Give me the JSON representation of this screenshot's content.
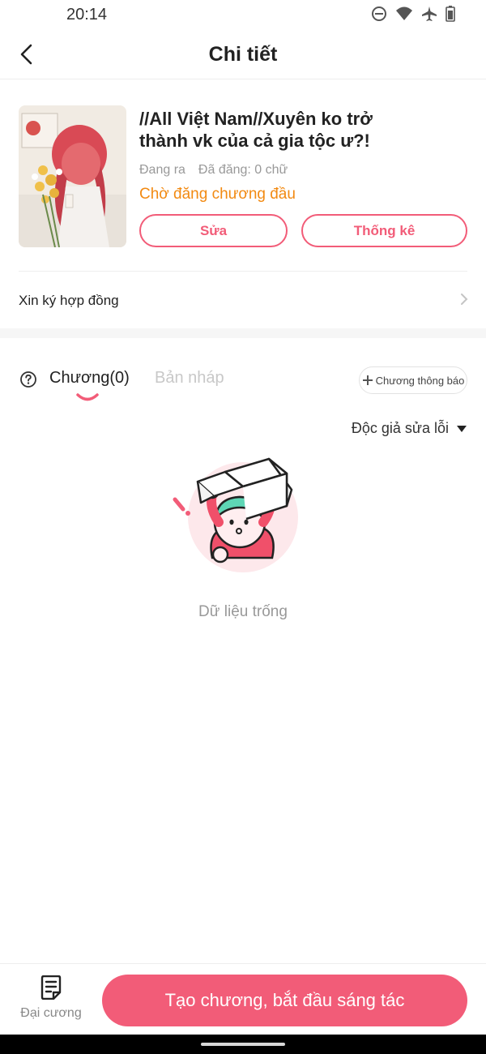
{
  "status_bar": {
    "time": "20:14",
    "icons": [
      "do-not-disturb-icon",
      "wifi-icon",
      "airplane-icon",
      "battery-icon"
    ]
  },
  "header": {
    "title": "Chi tiết",
    "back_icon": "chevron-left-icon"
  },
  "book": {
    "title": "//All Việt Nam//Xuyên ko trở thành vk của cả gia tộc ư?!",
    "state": "Đang ra",
    "posted": "Đã đăng: 0 chữ",
    "status": "Chờ đăng chương đầu",
    "edit_label": "Sửa",
    "stats_label": "Thống kê"
  },
  "contract": {
    "label": "Xin ký hợp đồng"
  },
  "tabs": {
    "chapters": "Chương(0)",
    "drafts": "Bản nháp",
    "announce_label": "Chương thông báo"
  },
  "sort": {
    "label": "Độc giả sửa lỗi"
  },
  "empty": {
    "text": "Dữ liệu trống"
  },
  "bottom": {
    "outline_label": "Đại cương",
    "create_label": "Tạo chương, bắt đầu sáng tác"
  },
  "colors": {
    "accent": "#f25c78",
    "status_orange": "#f28a12",
    "muted": "#999999"
  }
}
